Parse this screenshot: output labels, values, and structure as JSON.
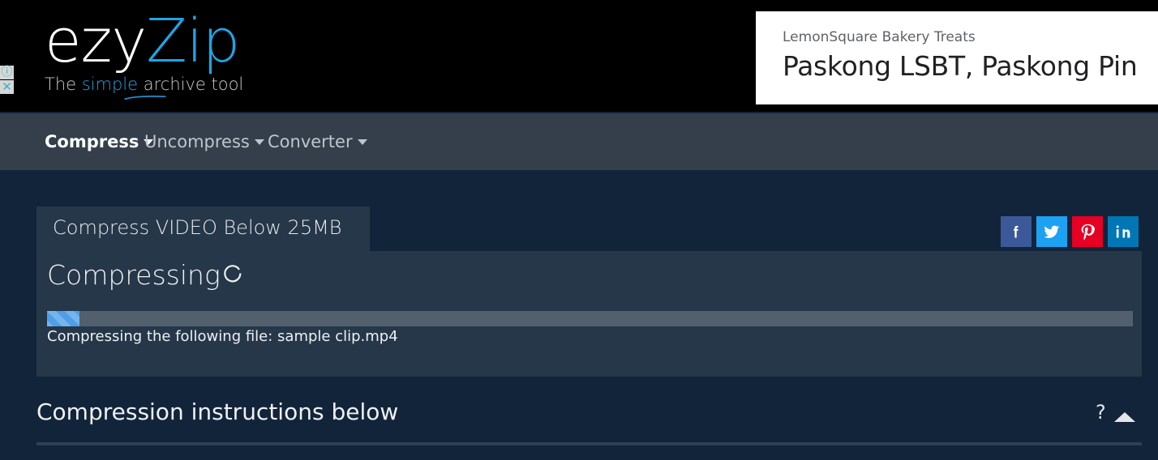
{
  "site": {
    "logo_primary": "ezy",
    "logo_secondary": "Zip",
    "tagline_pre": "The ",
    "tagline_highlight": "simple",
    "tagline_post": " archive tool"
  },
  "ad": {
    "advertiser": "LemonSquare Bakery Treats",
    "headline": "Paskong LSBT, Paskong Pin",
    "info_icon": "ⓘ",
    "close_icon": "✕"
  },
  "nav": {
    "items": [
      {
        "label": "Compress",
        "active": true
      },
      {
        "label": "Uncompress",
        "active": false
      },
      {
        "label": "Converter",
        "active": false
      }
    ]
  },
  "main": {
    "tab_title": "Compress VIDEO Below 25MB",
    "status_heading": "Compressing",
    "progress": {
      "percent": 3,
      "caption": "Compressing the following file: sample clip.mp4",
      "fill_color": "#4e9fe8",
      "track_color": "#52606e"
    },
    "instructions": {
      "title": "Compression instructions below",
      "help_label": "?"
    }
  },
  "social": {
    "items": [
      {
        "name": "Facebook",
        "color": "#3b5998"
      },
      {
        "name": "Twitter",
        "color": "#1da1f2"
      },
      {
        "name": "Pinterest",
        "color": "#e60023"
      },
      {
        "name": "LinkedIn",
        "color": "#0077b5"
      }
    ]
  }
}
